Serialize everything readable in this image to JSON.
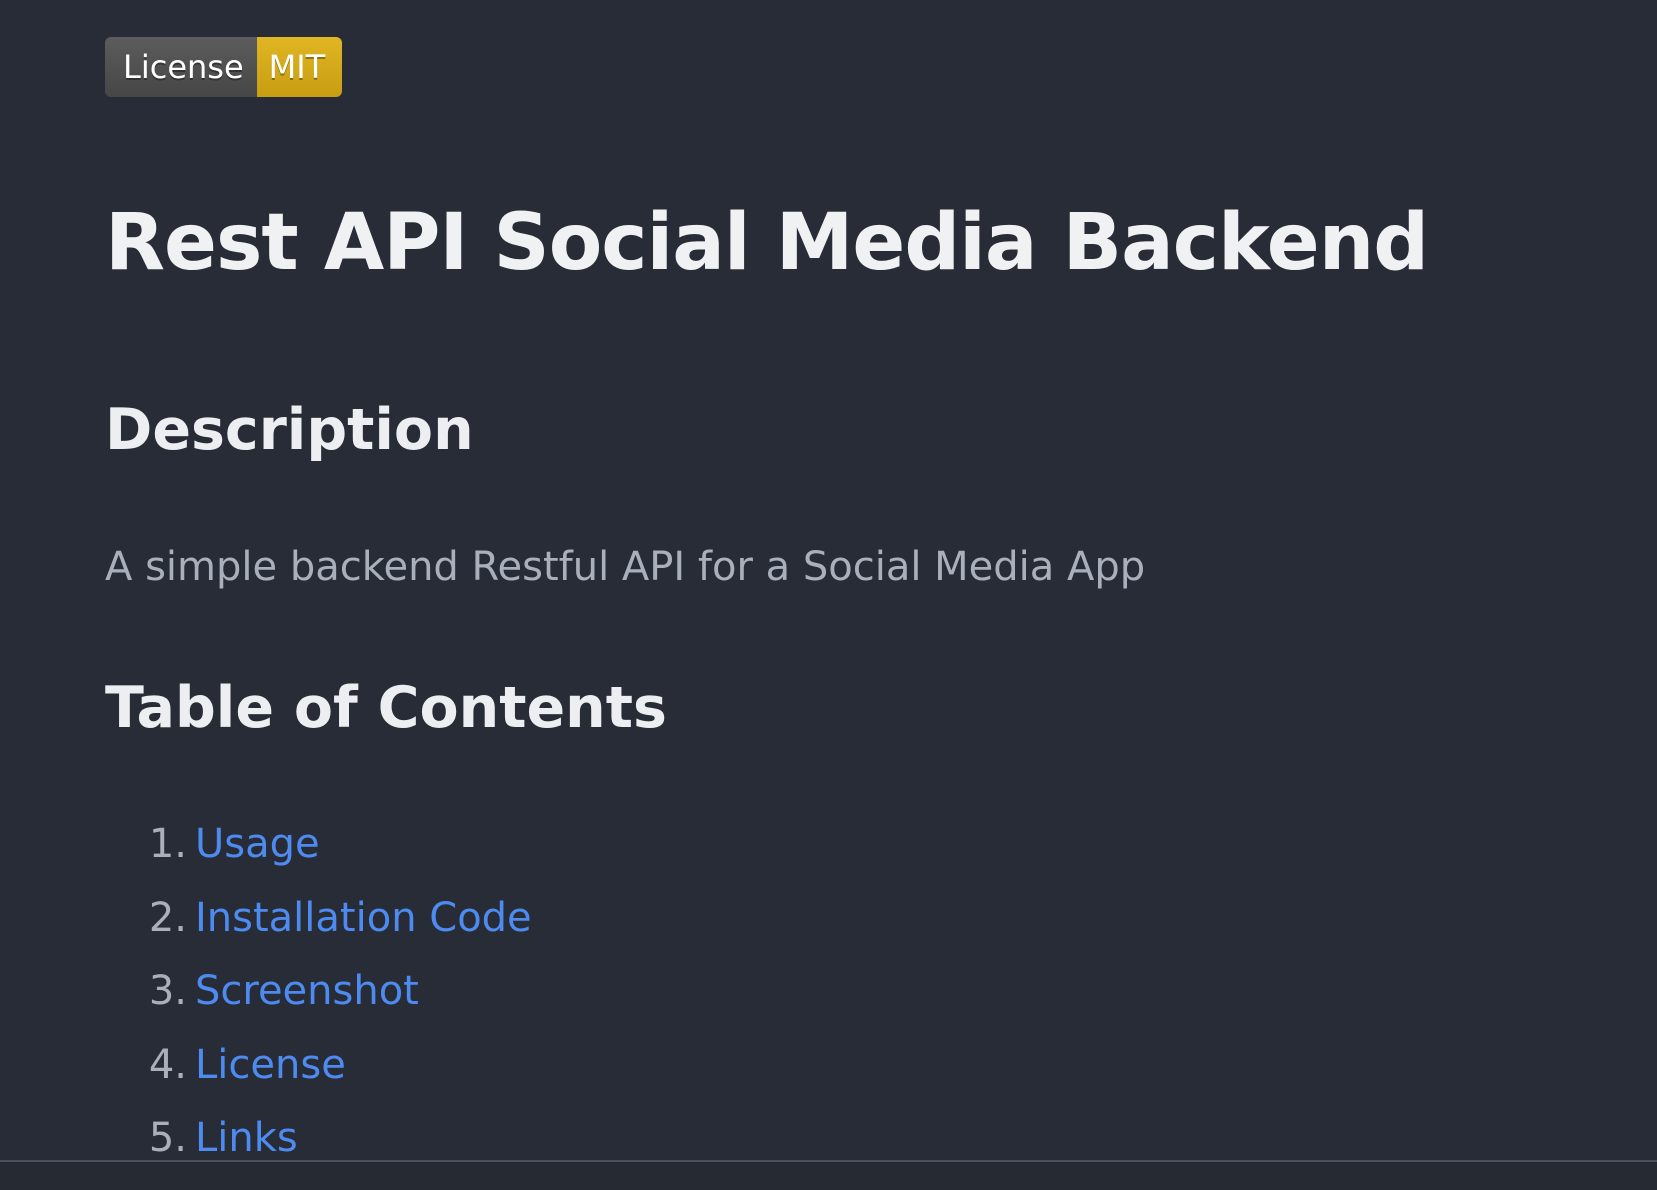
{
  "badge": {
    "label": "License",
    "value": "MIT",
    "label_color": "#555555",
    "value_color": "#dfb317"
  },
  "title": "Rest API Social Media Backend",
  "sections": {
    "description": {
      "heading": "Description",
      "text": "A simple backend Restful API for a Social Media App"
    },
    "toc": {
      "heading": "Table of Contents",
      "items": [
        {
          "num": "1.",
          "label": "Usage"
        },
        {
          "num": "2.",
          "label": "Installation Code"
        },
        {
          "num": "3.",
          "label": "Screenshot"
        },
        {
          "num": "4.",
          "label": "License"
        },
        {
          "num": "5.",
          "label": "Links"
        }
      ]
    }
  },
  "colors": {
    "background": "#282c36",
    "heading": "#eceef1",
    "body_text": "#a9b0bc",
    "link": "#4d8bf0"
  }
}
